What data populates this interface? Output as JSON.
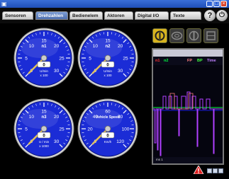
{
  "titlebar": {
    "icon": "app-icon"
  },
  "tabs": [
    {
      "label": "Sensoren"
    },
    {
      "label": "Drehzahlen"
    },
    {
      "label": "Bedienelem"
    },
    {
      "label": "Aktoren"
    },
    {
      "label": "Digital I/O"
    },
    {
      "label": "Texte"
    }
  ],
  "header_buttons": {
    "help": "?",
    "power": "⏻"
  },
  "gauges": [
    {
      "id": "n1",
      "title": "n1",
      "ticks": [
        "0",
        "5",
        "10",
        "15",
        "20",
        "25",
        "30"
      ],
      "unit_lines": [
        "U/min",
        "x 100"
      ],
      "value": "0",
      "reading": 0
    },
    {
      "id": "n2",
      "title": "n2",
      "ticks": [
        "0",
        "5",
        "10",
        "15",
        "20",
        "25",
        "30"
      ],
      "unit_lines": [
        "U/min",
        "x 100"
      ],
      "value": "0",
      "reading": 0
    },
    {
      "id": "n3",
      "title": "n3",
      "ticks": [
        "0",
        "5",
        "10",
        "15",
        "20",
        "25",
        "30"
      ],
      "unit_lines": [
        "U / min",
        "x 1000"
      ],
      "value": "0",
      "reading": 0
    },
    {
      "id": "speed",
      "title": "Vehicle Speed",
      "ticks": [
        "0",
        "20",
        "40",
        "60",
        "80",
        "100",
        "120"
      ],
      "unit_lines": [
        "Km/h"
      ],
      "value": "0",
      "reading": 0
    }
  ],
  "chart": {
    "legend": [
      {
        "label": "n1",
        "color": "#ff3030"
      },
      {
        "label": "n2",
        "color": "#00ff40"
      },
      {
        "label": "FP",
        "color": "#ff8080"
      },
      {
        "label": "BP",
        "color": "#40ff40"
      },
      {
        "label": "Time",
        "color": "#c080ff"
      }
    ],
    "x_label": "ms 1"
  },
  "colors": {
    "gauge_face": "#1b2cd6",
    "gauge_rim": "#d7d7d7",
    "trace_purple": "#b040ff",
    "trace_green": "#00ff40"
  }
}
